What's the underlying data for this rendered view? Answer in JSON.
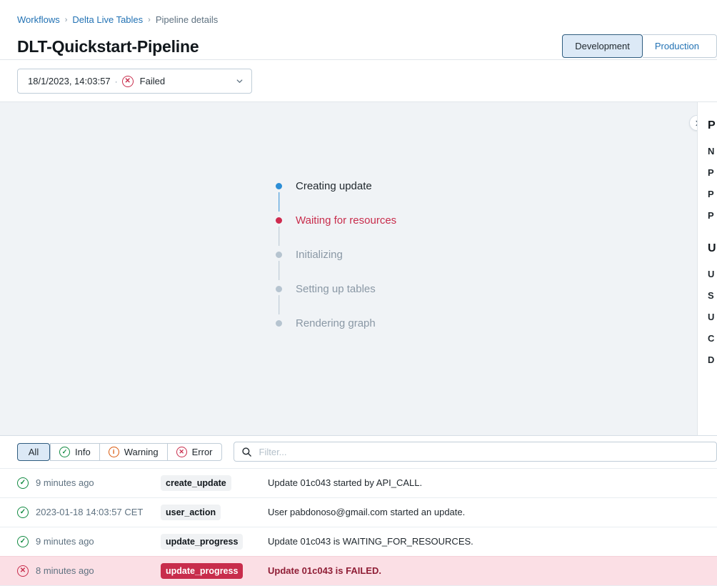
{
  "breadcrumb": {
    "items": [
      {
        "label": "Workflows",
        "type": "link"
      },
      {
        "label": "Delta Live Tables",
        "type": "link"
      },
      {
        "label": "Pipeline details",
        "type": "current"
      }
    ],
    "separator": "›"
  },
  "header": {
    "title": "DLT-Quickstart-Pipeline",
    "environment_toggle": {
      "options": [
        "Development",
        "Production"
      ],
      "selected": "Development"
    }
  },
  "run_selector": {
    "date": "18/1/2023, 14:03:57",
    "separator": "·",
    "status": "Failed",
    "status_icon": "error-circle-x-icon",
    "caret_icon": "chevron-down-icon"
  },
  "graph_panel": {
    "collapse_handle_icon": "chevron-right-icon",
    "steps": [
      {
        "label": "Creating update",
        "state": "done",
        "dot": "blue"
      },
      {
        "label": "Waiting for resources",
        "state": "failed",
        "dot": "red"
      },
      {
        "label": "Initializing",
        "state": "pending",
        "dot": "gray"
      },
      {
        "label": "Setting up tables",
        "state": "pending",
        "dot": "gray"
      },
      {
        "label": "Rendering graph",
        "state": "pending",
        "dot": "gray"
      }
    ]
  },
  "side_panel": {
    "section_one_heading": "P",
    "section_one_rows": [
      "N",
      "P",
      "P",
      "P"
    ],
    "section_two_heading": "U",
    "section_two_rows": [
      "U",
      "S",
      "U",
      "C",
      "D"
    ]
  },
  "event_log": {
    "filters": [
      {
        "label": "All",
        "icon": "none",
        "selected": true
      },
      {
        "label": "Info",
        "icon": "check-circle-icon",
        "selected": false
      },
      {
        "label": "Warning",
        "icon": "info-circle-icon",
        "selected": false
      },
      {
        "label": "Error",
        "icon": "error-circle-icon",
        "selected": false
      }
    ],
    "search": {
      "placeholder": "Filter...",
      "value": "",
      "icon": "search-icon"
    },
    "rows": [
      {
        "status": "info",
        "status_icon": "check-circle-icon",
        "time": "9 minutes ago",
        "type": "create_update",
        "message": "Update 01c043 started by API_CALL."
      },
      {
        "status": "info",
        "status_icon": "check-circle-icon",
        "time": "2023-01-18 14:03:57 CET",
        "type": "user_action",
        "message": "User pabdonoso@gmail.com started an update."
      },
      {
        "status": "info",
        "status_icon": "check-circle-icon",
        "time": "9 minutes ago",
        "type": "update_progress",
        "message": "Update 01c043 is WAITING_FOR_RESOURCES."
      },
      {
        "status": "error",
        "status_icon": "error-circle-icon",
        "time": "8 minutes ago",
        "type": "update_progress",
        "message": "Update 01c043 is FAILED."
      }
    ]
  },
  "colors": {
    "link": "#2272b4",
    "selected_bg": "#dce9f6",
    "selected_border": "#2f5c7f",
    "error_red": "#c82d4c",
    "error_row_bg": "#fbdfe5",
    "error_text": "#8f1d35",
    "success_green": "#128a42",
    "warning_orange": "#d9590d",
    "step_active_blue": "#2d8ed6",
    "step_pending_gray": "#b6c4d0",
    "canvas_bg": "#f0f3f6"
  }
}
